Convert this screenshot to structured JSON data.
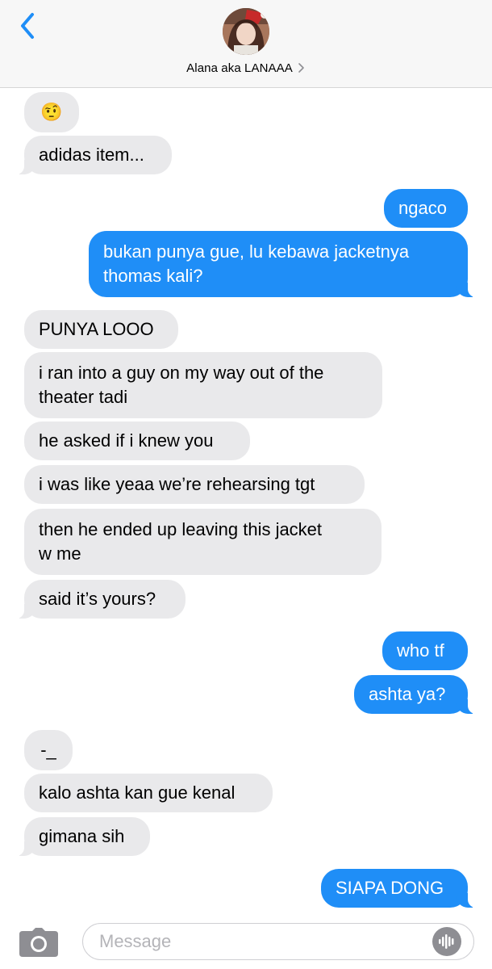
{
  "header": {
    "contact_name": "Alana aka LANAAA",
    "back_icon": "chevron-left-icon",
    "detail_icon": "chevron-right-icon"
  },
  "messages": [
    {
      "dir": "in",
      "text": "🤨"
    },
    {
      "dir": "in",
      "text": "adidas item..."
    },
    {
      "dir": "out",
      "text": "ngaco"
    },
    {
      "dir": "out",
      "text": "bukan punya gue, lu kebawa jacketnya\nthomas kali?"
    },
    {
      "dir": "in",
      "text": "PUNYA LOOO"
    },
    {
      "dir": "in",
      "text": "i ran into a guy on my way out of the\ntheater tadi"
    },
    {
      "dir": "in",
      "text": "he asked if i knew you"
    },
    {
      "dir": "in",
      "text": "i was like yeaa we’re rehearsing tgt"
    },
    {
      "dir": "in",
      "text": "then he ended up leaving this jacket\nw me"
    },
    {
      "dir": "in",
      "text": "said it’s yours?"
    },
    {
      "dir": "out",
      "text": "who tf"
    },
    {
      "dir": "out",
      "text": "ashta ya?"
    },
    {
      "dir": "in",
      "text": "-_"
    },
    {
      "dir": "in",
      "text": "kalo ashta kan gue kenal"
    },
    {
      "dir": "in",
      "text": "gimana sih"
    },
    {
      "dir": "out",
      "text": "SIAPA DONG"
    }
  ],
  "composer": {
    "placeholder": "Message",
    "value": "",
    "camera_icon": "camera-icon",
    "audio_icon": "audio-waveform-icon"
  },
  "colors": {
    "outgoing_bubble": "#1f8ef7",
    "incoming_bubble": "#e9e9eb",
    "accent": "#1f8ef7"
  }
}
